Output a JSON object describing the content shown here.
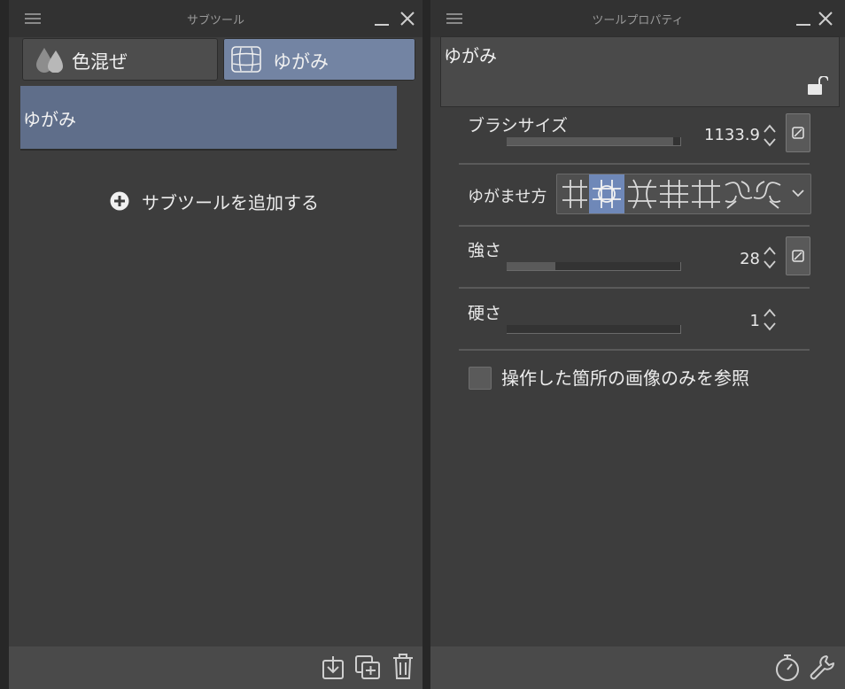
{
  "subtool_panel": {
    "title": "サブツール",
    "tabs": [
      {
        "label": "色混ぜ",
        "icon": "droplets-icon",
        "active": false
      },
      {
        "label": "ゆがみ",
        "icon": "grid-warp-icon",
        "active": true
      }
    ],
    "selected_subtool": "ゆがみ",
    "add_subtool_label": "サブツールを追加する",
    "footer_icons": [
      "import-icon",
      "duplicate-icon",
      "trash-icon"
    ]
  },
  "toolprop_panel": {
    "title": "ツールプロパティ",
    "tool_name": "ゆがみ",
    "locked": false,
    "brush_size": {
      "label": "ブラシサイズ",
      "value": "1133.9",
      "fraction": 0.96
    },
    "warp_method": {
      "label": "ゆがませ方",
      "options": [
        "push-warp-icon",
        "expand-warp-icon",
        "shrink-warp-icon",
        "pinch-warp-icon",
        "expand-shrink-icon",
        "twist-ccw-icon",
        "twist-cw-icon"
      ],
      "selected_index": 1
    },
    "strength": {
      "label": "強さ",
      "value": "28",
      "fraction": 0.28
    },
    "hardness": {
      "label": "硬さ",
      "value": "1",
      "fraction": 0.0
    },
    "reference_only_operated": {
      "label": "操作した箇所の画像のみを参照",
      "checked": false
    },
    "footer_icons": [
      "timer-reset-icon",
      "wrench-icon"
    ]
  },
  "colors": {
    "panel_bg": "#3d3d3d",
    "titlebar_bg": "#323232",
    "active_tab": "#7384a3",
    "selected_row": "#5f6e8a",
    "selected_warp": "#6f88b8"
  }
}
